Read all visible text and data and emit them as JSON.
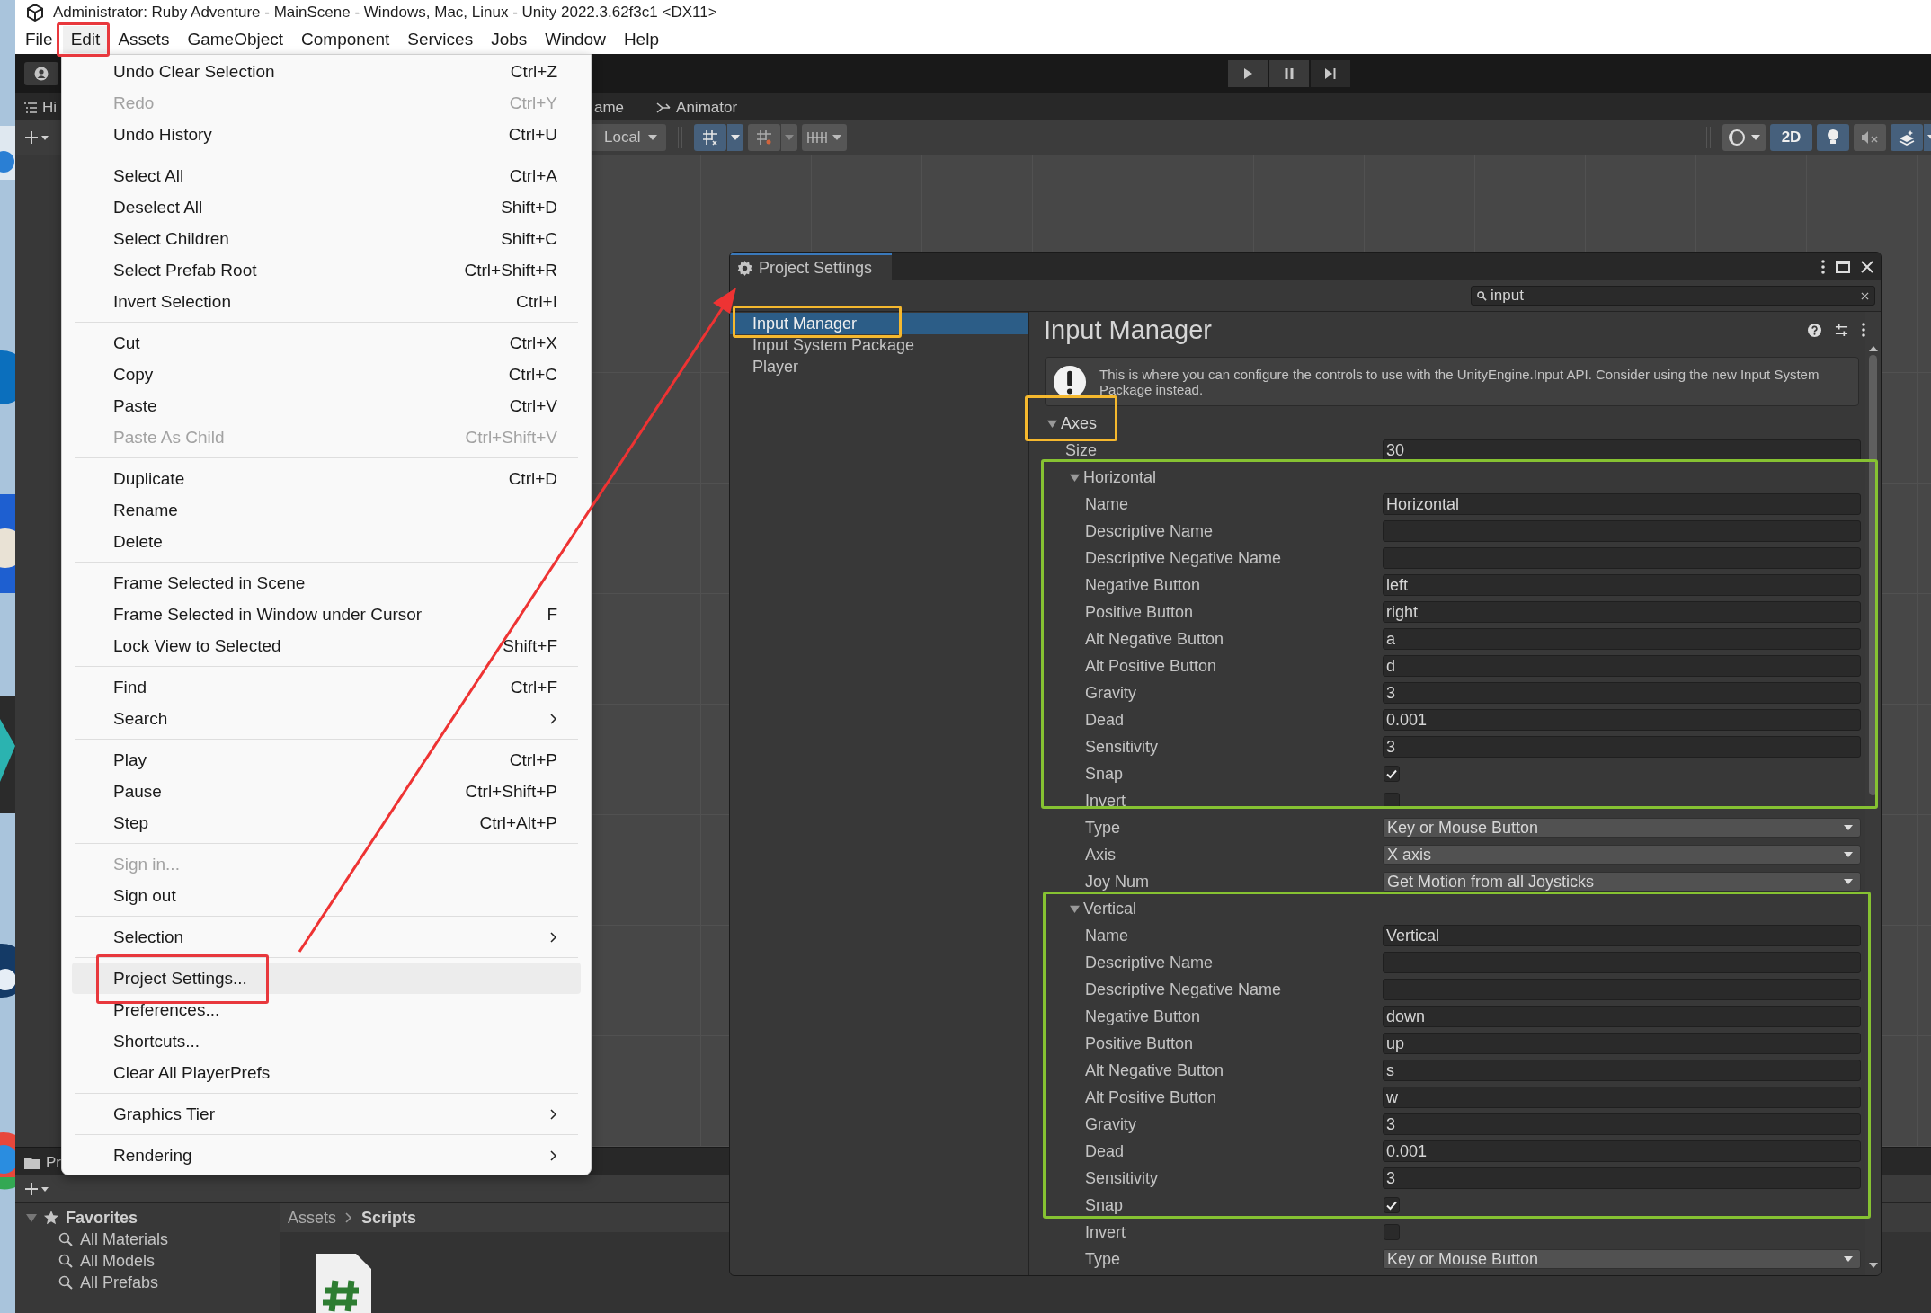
{
  "window": {
    "title": "Administrator: Ruby Adventure - MainScene - Windows, Mac, Linux - Unity 2022.3.62f3c1 <DX11>"
  },
  "menu_bar": [
    {
      "label": "File",
      "selected": false
    },
    {
      "label": "Edit",
      "selected": true
    },
    {
      "label": "Assets",
      "selected": false
    },
    {
      "label": "GameObject",
      "selected": false
    },
    {
      "label": "Component",
      "selected": false
    },
    {
      "label": "Services",
      "selected": false
    },
    {
      "label": "Jobs",
      "selected": false
    },
    {
      "label": "Window",
      "selected": false
    },
    {
      "label": "Help",
      "selected": false
    }
  ],
  "edit_menu": {
    "sections": [
      [
        {
          "label": "Undo Clear Selection",
          "shortcut": "Ctrl+Z",
          "disabled": false,
          "highlighted": false,
          "submenu": false
        },
        {
          "label": "Redo",
          "shortcut": "Ctrl+Y",
          "disabled": true,
          "highlighted": false,
          "submenu": false
        },
        {
          "label": "Undo History",
          "shortcut": "Ctrl+U",
          "disabled": false,
          "highlighted": false,
          "submenu": false
        }
      ],
      [
        {
          "label": "Select All",
          "shortcut": "Ctrl+A",
          "disabled": false,
          "highlighted": false,
          "submenu": false
        },
        {
          "label": "Deselect All",
          "shortcut": "Shift+D",
          "disabled": false,
          "highlighted": false,
          "submenu": false
        },
        {
          "label": "Select Children",
          "shortcut": "Shift+C",
          "disabled": false,
          "highlighted": false,
          "submenu": false
        },
        {
          "label": "Select Prefab Root",
          "shortcut": "Ctrl+Shift+R",
          "disabled": false,
          "highlighted": false,
          "submenu": false
        },
        {
          "label": "Invert Selection",
          "shortcut": "Ctrl+I",
          "disabled": false,
          "highlighted": false,
          "submenu": false
        }
      ],
      [
        {
          "label": "Cut",
          "shortcut": "Ctrl+X",
          "disabled": false,
          "highlighted": false,
          "submenu": false
        },
        {
          "label": "Copy",
          "shortcut": "Ctrl+C",
          "disabled": false,
          "highlighted": false,
          "submenu": false
        },
        {
          "label": "Paste",
          "shortcut": "Ctrl+V",
          "disabled": false,
          "highlighted": false,
          "submenu": false
        },
        {
          "label": "Paste As Child",
          "shortcut": "Ctrl+Shift+V",
          "disabled": true,
          "highlighted": false,
          "submenu": false
        }
      ],
      [
        {
          "label": "Duplicate",
          "shortcut": "Ctrl+D",
          "disabled": false,
          "highlighted": false,
          "submenu": false
        },
        {
          "label": "Rename",
          "disabled": false,
          "highlighted": false,
          "submenu": false
        },
        {
          "label": "Delete",
          "disabled": false,
          "highlighted": false,
          "submenu": false
        }
      ],
      [
        {
          "label": "Frame Selected in Scene",
          "disabled": false,
          "highlighted": false,
          "submenu": false
        },
        {
          "label": "Frame Selected in Window under Cursor",
          "shortcut": "F",
          "disabled": false,
          "highlighted": false,
          "submenu": false
        },
        {
          "label": "Lock View to Selected",
          "shortcut": "Shift+F",
          "disabled": false,
          "highlighted": false,
          "submenu": false
        }
      ],
      [
        {
          "label": "Find",
          "shortcut": "Ctrl+F",
          "disabled": false,
          "highlighted": false,
          "submenu": false
        },
        {
          "label": "Search",
          "disabled": false,
          "highlighted": false,
          "submenu": true
        }
      ],
      [
        {
          "label": "Play",
          "shortcut": "Ctrl+P",
          "disabled": false,
          "highlighted": false,
          "submenu": false
        },
        {
          "label": "Pause",
          "shortcut": "Ctrl+Shift+P",
          "disabled": false,
          "highlighted": false,
          "submenu": false
        },
        {
          "label": "Step",
          "shortcut": "Ctrl+Alt+P",
          "disabled": false,
          "highlighted": false,
          "submenu": false
        }
      ],
      [
        {
          "label": "Sign in...",
          "disabled": true,
          "highlighted": false,
          "submenu": false
        },
        {
          "label": "Sign out",
          "disabled": false,
          "highlighted": false,
          "submenu": false
        }
      ],
      [
        {
          "label": "Selection",
          "disabled": false,
          "highlighted": false,
          "submenu": true
        }
      ],
      [
        {
          "label": "Project Settings...",
          "disabled": false,
          "highlighted": true,
          "submenu": false
        },
        {
          "label": "Preferences...",
          "disabled": false,
          "highlighted": false,
          "submenu": false
        },
        {
          "label": "Shortcuts...",
          "disabled": false,
          "highlighted": false,
          "submenu": false
        },
        {
          "label": "Clear All PlayerPrefs",
          "disabled": false,
          "highlighted": false,
          "submenu": false
        }
      ],
      [
        {
          "label": "Graphics Tier",
          "disabled": false,
          "highlighted": false,
          "submenu": true
        }
      ],
      [
        {
          "label": "Rendering",
          "disabled": false,
          "highlighted": false,
          "submenu": true
        }
      ]
    ]
  },
  "hierarchy": {
    "tab": "Hi"
  },
  "scene_panel": {
    "tabs": [
      "ame",
      "Animator"
    ],
    "pivot": "Local",
    "mode_button": "2D"
  },
  "project_panel": {
    "tab": "Pr",
    "favorites": {
      "label": "Favorites",
      "expanded": true,
      "children": [
        {
          "label": "All Materials"
        },
        {
          "label": "All Models"
        },
        {
          "label": "All Prefabs"
        }
      ]
    },
    "breadcrumb": [
      "Assets",
      "Scripts"
    ]
  },
  "project_settings": {
    "title": "Project Settings",
    "search": {
      "value": "input"
    },
    "sidebar": [
      {
        "label": "Input Manager",
        "selected": true
      },
      {
        "label": "Input System Package",
        "selected": false
      },
      {
        "label": "Player",
        "selected": false
      }
    ],
    "heading": "Input Manager",
    "info": "This is where you can configure the controls to use with the UnityEngine.Input API. Consider using the new Input System Package instead.",
    "axes": {
      "label": "Axes",
      "expanded": true,
      "size_label": "Size",
      "size": "30",
      "entries": [
        {
          "label": "Horizontal",
          "expanded": true,
          "fields": [
            {
              "kind": "text",
              "label": "Name",
              "value": "Horizontal"
            },
            {
              "kind": "text",
              "label": "Descriptive Name"
            },
            {
              "kind": "text",
              "label": "Descriptive Negative Name"
            },
            {
              "kind": "text",
              "label": "Negative Button",
              "value": "left"
            },
            {
              "kind": "text",
              "label": "Positive Button",
              "value": "right"
            },
            {
              "kind": "text",
              "label": "Alt Negative Button",
              "value": "a"
            },
            {
              "kind": "text",
              "label": "Alt Positive Button",
              "value": "d"
            },
            {
              "kind": "text",
              "label": "Gravity",
              "value": "3"
            },
            {
              "kind": "text",
              "label": "Dead",
              "value": "0.001"
            },
            {
              "kind": "text",
              "label": "Sensitivity",
              "value": "3"
            },
            {
              "kind": "checkbox",
              "label": "Snap",
              "checked": true
            },
            {
              "kind": "checkbox",
              "label": "Invert",
              "checked": false
            },
            {
              "kind": "dropdown",
              "label": "Type",
              "value": "Key or Mouse Button"
            },
            {
              "kind": "dropdown",
              "label": "Axis",
              "value": "X axis"
            },
            {
              "kind": "dropdown",
              "label": "Joy Num",
              "value": "Get Motion from all Joysticks"
            }
          ]
        },
        {
          "label": "Vertical",
          "expanded": true,
          "fields": [
            {
              "kind": "text",
              "label": "Name",
              "value": "Vertical"
            },
            {
              "kind": "text",
              "label": "Descriptive Name"
            },
            {
              "kind": "text",
              "label": "Descriptive Negative Name"
            },
            {
              "kind": "text",
              "label": "Negative Button",
              "value": "down"
            },
            {
              "kind": "text",
              "label": "Positive Button",
              "value": "up"
            },
            {
              "kind": "text",
              "label": "Alt Negative Button",
              "value": "s"
            },
            {
              "kind": "text",
              "label": "Alt Positive Button",
              "value": "w"
            },
            {
              "kind": "text",
              "label": "Gravity",
              "value": "3"
            },
            {
              "kind": "text",
              "label": "Dead",
              "value": "0.001"
            },
            {
              "kind": "text",
              "label": "Sensitivity",
              "value": "3"
            },
            {
              "kind": "checkbox",
              "label": "Snap",
              "checked": true
            },
            {
              "kind": "checkbox",
              "label": "Invert",
              "checked": false
            },
            {
              "kind": "dropdown",
              "label": "Type",
              "value": "Key or Mouse Button"
            }
          ]
        }
      ]
    }
  }
}
